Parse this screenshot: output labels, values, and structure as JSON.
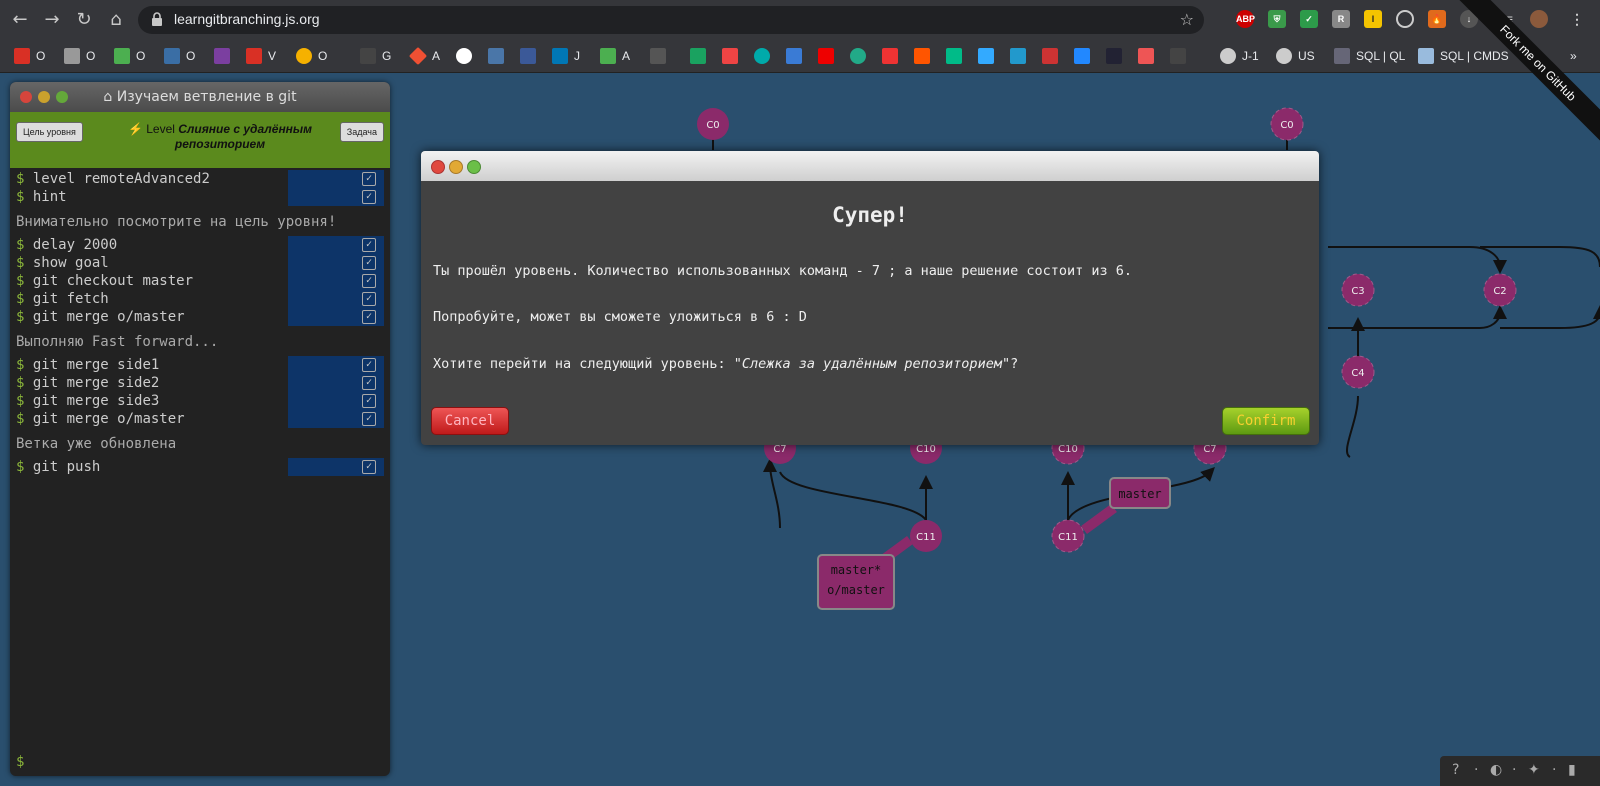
{
  "browser": {
    "url": "learngitbranching.js.org",
    "extensions": [
      "ABP",
      "shield",
      "2",
      "R",
      "l",
      "speed",
      "fire",
      "down",
      "media"
    ],
    "bookmarks": [
      {
        "icon": "gmail-icon",
        "label": "O",
        "color": "#d93025"
      },
      {
        "icon": "doc-icon",
        "label": "O",
        "color": "#999"
      },
      {
        "icon": "drive-icon",
        "label": "O",
        "color": "#4caf50"
      },
      {
        "icon": "grid-icon",
        "label": "O",
        "color": "#3a6ea5"
      },
      {
        "icon": "hat-icon",
        "label": "",
        "color": "#7b3fa0"
      },
      {
        "icon": "gmail-icon",
        "label": "V",
        "color": "#d93025"
      },
      {
        "icon": "ball-icon",
        "label": "O",
        "color": "#f6b100"
      },
      {
        "icon": "dark-icon",
        "label": "G",
        "color": "#444"
      },
      {
        "icon": "git-icon",
        "label": "A",
        "color": "#f05033"
      },
      {
        "icon": "google-icon",
        "label": "",
        "color": "#fff"
      },
      {
        "icon": "vk-icon",
        "label": "",
        "color": "#4a76a8"
      },
      {
        "icon": "fb-icon",
        "label": "",
        "color": "#3b5998"
      },
      {
        "icon": "in-icon",
        "label": "J",
        "color": "#0077b5"
      },
      {
        "icon": "drive-icon",
        "label": "A",
        "color": "#4caf50"
      }
    ],
    "bookmarks_right": [
      "J-1",
      "US",
      "SQL | QL",
      "SQL | CMDS"
    ]
  },
  "panel": {
    "title": "Изучаем ветвление в git",
    "goal_button": "Цель уровня",
    "task_button": "Задача",
    "level_prefix": "Level",
    "level_name": "Слияние с удалённым репозиторием",
    "commands_1": [
      "level remoteAdvanced2",
      "hint"
    ],
    "message_1": "Внимательно посмотрите на цель уровня!",
    "commands_2": [
      "delay 2000",
      "show goal",
      "git checkout master",
      "git fetch",
      "git merge o/master"
    ],
    "message_2": "Выполняю Fast forward...",
    "commands_3": [
      "git merge side1",
      "git merge side2",
      "git merge side3",
      "git merge o/master"
    ],
    "message_3": "Ветка уже обновлена",
    "commands_4": [
      "git push"
    ],
    "prompt": "$",
    "dollar": "$",
    "check": "✓"
  },
  "modal": {
    "heading": "Супер!",
    "line1": "Ты прошёл уровень. Количество использованных команд - 7 ; а наше решение состоит из 6.",
    "line2": "Попробуйте, может вы сможете уложиться в 6 : D",
    "line3_prefix": "Хотите перейти на следующий уровень: ",
    "line3_level": "\"Слежка за удалённым репозиторием\"",
    "line3_suffix": "?",
    "cancel": "Cancel",
    "confirm": "Confirm"
  },
  "graph": {
    "nodes_left": [
      "C0",
      "C7",
      "C10",
      "C11"
    ],
    "nodes_right": [
      "C0",
      "C3",
      "C2",
      "C4",
      "C10",
      "C7",
      "C11"
    ],
    "label_left_1": "master*",
    "label_left_2": "o/master",
    "label_right": "master"
  },
  "ribbon": "Fork me on GitHub"
}
